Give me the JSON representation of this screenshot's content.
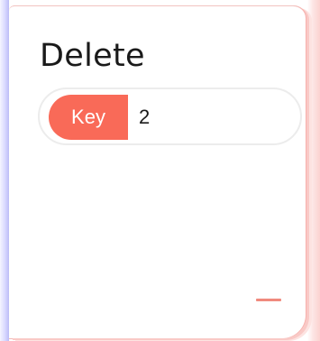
{
  "panel": {
    "title": "Delete",
    "field": {
      "key_label": "Key",
      "value": "2"
    },
    "minimize_icon": "minus-icon"
  },
  "colors": {
    "accent": "#f96a58",
    "minimize": "#f08a7e"
  }
}
